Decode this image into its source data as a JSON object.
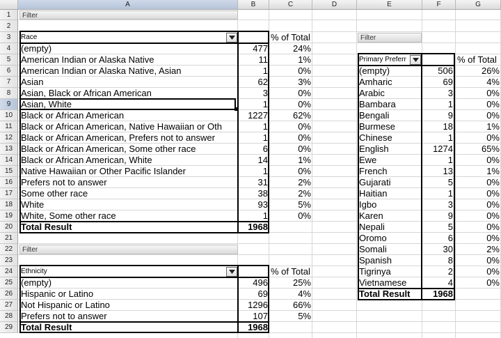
{
  "columns": [
    "A",
    "B",
    "C",
    "D",
    "E",
    "F",
    "G"
  ],
  "rows": [
    "1",
    "2",
    "3",
    "4",
    "5",
    "6",
    "7",
    "8",
    "9",
    "10",
    "11",
    "12",
    "13",
    "14",
    "15",
    "16",
    "17",
    "18",
    "19",
    "20",
    "21",
    "22",
    "23",
    "24",
    "25",
    "26",
    "27",
    "28",
    "29"
  ],
  "selected": {
    "column": "A",
    "row": "9"
  },
  "filter_label": "Filter",
  "race_table": {
    "header": "Race",
    "pct_header": "% of Total",
    "rows": [
      [
        "(empty)",
        "477",
        "24%"
      ],
      [
        "American Indian or Alaska Native",
        "11",
        "1%"
      ],
      [
        "American Indian or Alaska Native, Asian",
        "1",
        "0%"
      ],
      [
        "Asian",
        "62",
        "3%"
      ],
      [
        "Asian, Black or African American",
        "3",
        "0%"
      ],
      [
        "Asian, White",
        "1",
        "0%"
      ],
      [
        "Black or African American",
        "1227",
        "62%"
      ],
      [
        "Black or African American, Native Hawaiian or Oth",
        "1",
        "0%"
      ],
      [
        "Black or African American, Prefers not to answer",
        "1",
        "0%"
      ],
      [
        "Black or African American, Some other race",
        "6",
        "0%"
      ],
      [
        "Black or African American, White",
        "14",
        "1%"
      ],
      [
        "Native Hawaiian or Other Pacific Islander",
        "1",
        "0%"
      ],
      [
        "Prefers not to answer",
        "31",
        "2%"
      ],
      [
        "Some other race",
        "38",
        "2%"
      ],
      [
        "White",
        "93",
        "5%"
      ],
      [
        "White, Some other race",
        "1",
        "0%"
      ]
    ],
    "total_label": "Total Result",
    "total_value": "1968"
  },
  "ethnicity_table": {
    "header": "Ethnicity",
    "pct_header": "% of Total",
    "rows": [
      [
        "(empty)",
        "496",
        "25%"
      ],
      [
        "Hispanic or Latino",
        "69",
        "4%"
      ],
      [
        "Not Hispanic or Latino",
        "1296",
        "66%"
      ],
      [
        "Prefers not to answer",
        "107",
        "5%"
      ]
    ],
    "total_label": "Total Result",
    "total_value": "1968"
  },
  "language_table": {
    "header": "Primary Preferr",
    "pct_header": "% of Total",
    "rows": [
      [
        "(empty)",
        "506",
        "26%"
      ],
      [
        "Amharic",
        "69",
        "4%"
      ],
      [
        "Arabic",
        "3",
        "0%"
      ],
      [
        "Bambara",
        "1",
        "0%"
      ],
      [
        "Bengali",
        "9",
        "0%"
      ],
      [
        "Burmese",
        "18",
        "1%"
      ],
      [
        "Chinese",
        "1",
        "0%"
      ],
      [
        "English",
        "1274",
        "65%"
      ],
      [
        "Ewe",
        "1",
        "0%"
      ],
      [
        "French",
        "13",
        "1%"
      ],
      [
        "Gujarati",
        "5",
        "0%"
      ],
      [
        "Haitian",
        "1",
        "0%"
      ],
      [
        "Igbo",
        "3",
        "0%"
      ],
      [
        "Karen",
        "9",
        "0%"
      ],
      [
        "Nepali",
        "5",
        "0%"
      ],
      [
        "Oromo",
        "6",
        "0%"
      ],
      [
        "Somali",
        "30",
        "2%"
      ],
      [
        "Spanish",
        "8",
        "0%"
      ],
      [
        "Tigrinya",
        "2",
        "0%"
      ],
      [
        "Vietnamese",
        "4",
        "0%"
      ]
    ],
    "total_label": "Total Result",
    "total_value": "1968"
  }
}
